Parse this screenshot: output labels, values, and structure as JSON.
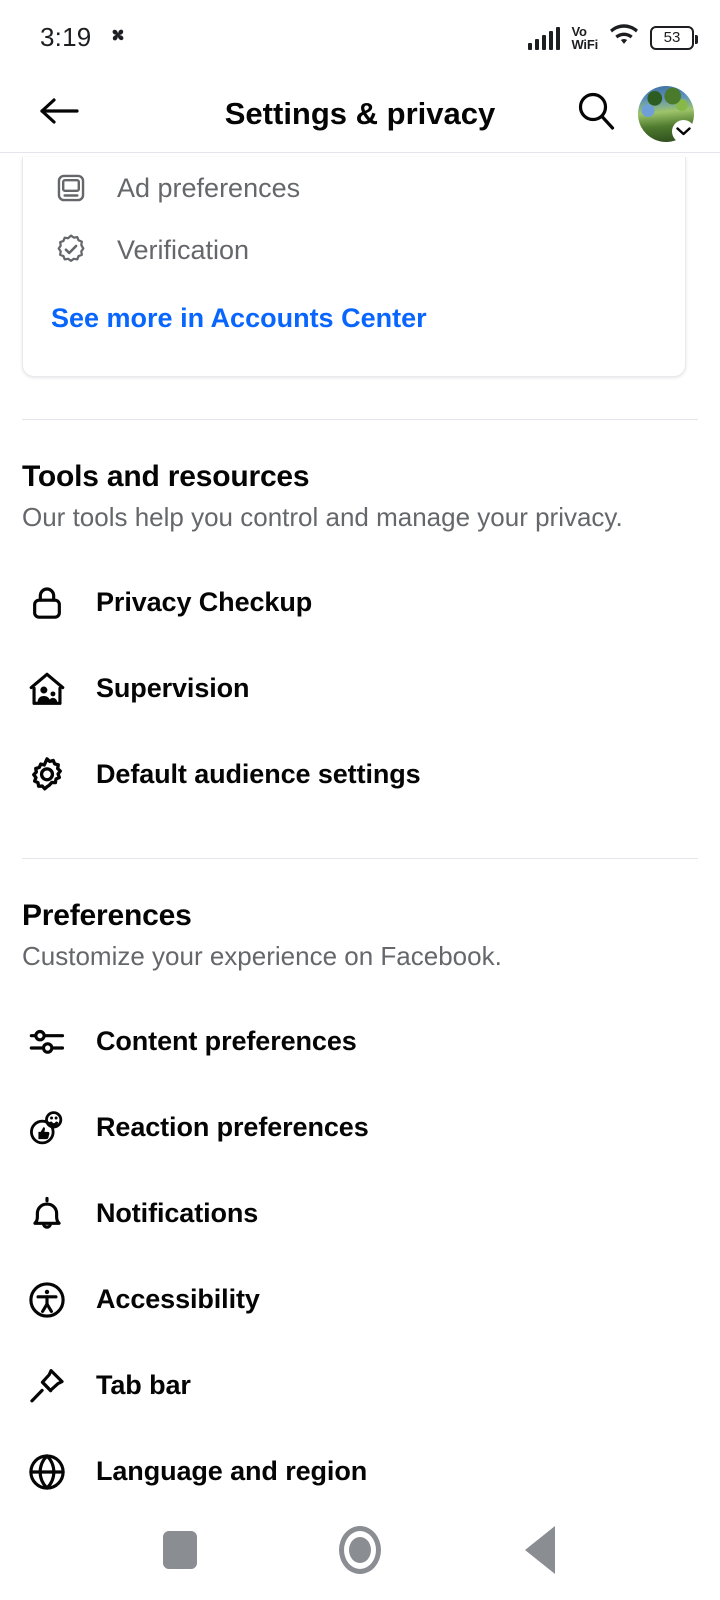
{
  "status_bar": {
    "time": "3:19",
    "fan_icon": "pinwheel-icon",
    "network_label": "Vo",
    "network_label2": "WiFi",
    "battery_percent": "53"
  },
  "header": {
    "title": "Settings & privacy",
    "back_icon": "back-arrow-icon",
    "search_icon": "search-icon",
    "avatar_icon": "profile-avatar",
    "avatar_badge_icon": "chevron-down-icon"
  },
  "accounts_center_card": {
    "items": [
      {
        "label": "Ad preferences",
        "icon": "ad-preferences-icon"
      },
      {
        "label": "Verification",
        "icon": "verification-badge-icon"
      }
    ],
    "link_label": "See more in Accounts Center",
    "link_color": "#0866ff"
  },
  "tools_section": {
    "title": "Tools and resources",
    "subtitle": "Our tools help you control and manage your privacy.",
    "items": [
      {
        "label": "Privacy Checkup",
        "icon": "lock-icon"
      },
      {
        "label": "Supervision",
        "icon": "supervision-house-icon"
      },
      {
        "label": "Default audience settings",
        "icon": "gear-icon"
      }
    ]
  },
  "preferences_section": {
    "title": "Preferences",
    "subtitle": "Customize your experience on Facebook.",
    "items": [
      {
        "label": "Content preferences",
        "icon": "sliders-icon"
      },
      {
        "label": "Reaction preferences",
        "icon": "reaction-thumbsup-icon"
      },
      {
        "label": "Notifications",
        "icon": "bell-icon"
      },
      {
        "label": "Accessibility",
        "icon": "accessibility-icon"
      },
      {
        "label": "Tab bar",
        "icon": "pushpin-icon"
      },
      {
        "label": "Language and region",
        "icon": "globe-icon"
      }
    ]
  },
  "nav_bar": {
    "recents_label": "recents-square-icon",
    "home_label": "home-circle-icon",
    "back_label": "back-triangle-icon"
  }
}
